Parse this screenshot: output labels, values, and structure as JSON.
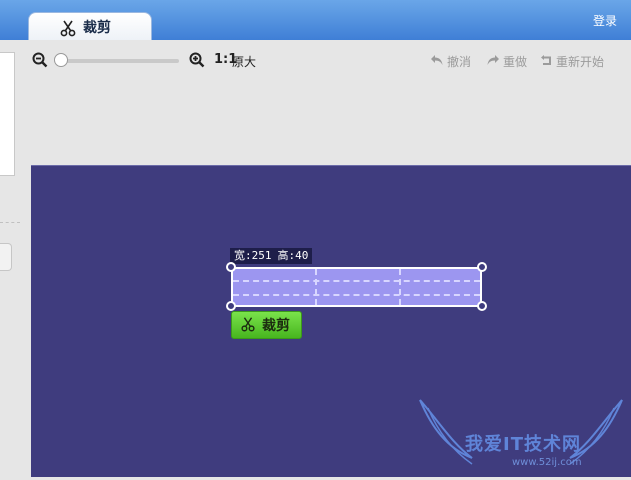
{
  "window": {
    "tab_title": "裁剪",
    "login_label": "登录"
  },
  "toolbar": {
    "zoom_ratio": "1:1",
    "zoom_original": "原大",
    "undo_label": "撤消",
    "redo_label": "重做",
    "restart_label": "重新开始"
  },
  "crop": {
    "width_text": "宽:251",
    "height_text": "高:40",
    "button_label": "裁剪"
  },
  "watermark": {
    "text": "我爱IT技术网",
    "url": "www.52ij.com"
  },
  "colors": {
    "canvas": "#3f3c7e",
    "crop_fill": "#9c96f0",
    "crop_button": "#5fcb2e",
    "topbar": "#4f8fe0"
  }
}
